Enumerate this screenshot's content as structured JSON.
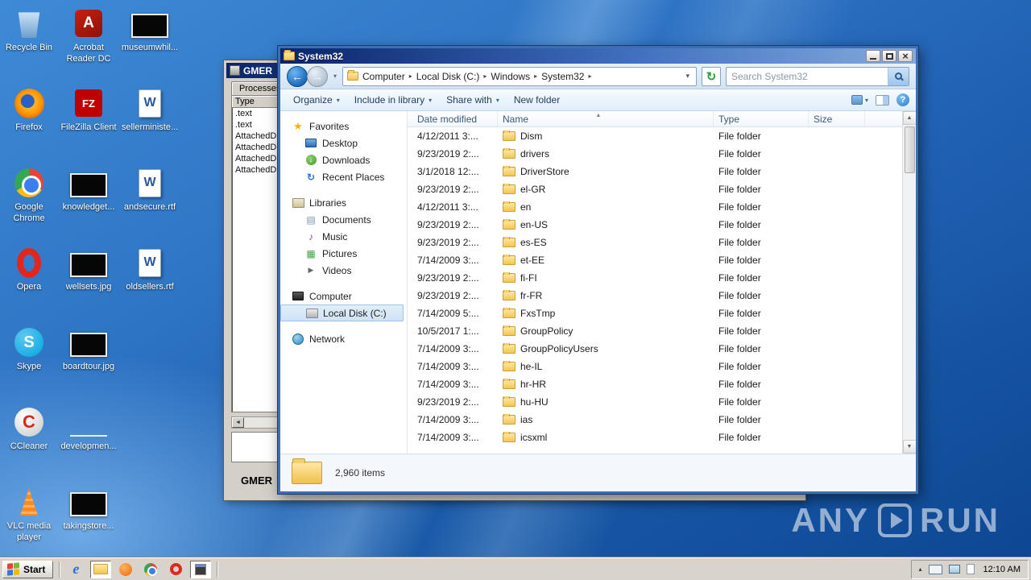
{
  "colors": {
    "window_border": "#3d6db5",
    "selection_blue": "#cfe3f6",
    "wallpaper_blue": "#2e74c4",
    "folder_yellow": "#f3c64f"
  },
  "desktop": {
    "icons": [
      {
        "label": "Recycle Bin",
        "kind": "recycle-bin",
        "col": 0,
        "row": 0
      },
      {
        "label": "Acrobat Reader DC",
        "kind": "acrobat",
        "col": 1,
        "row": 0
      },
      {
        "label": "museumwhil...",
        "kind": "image-black",
        "col": 2,
        "row": 0
      },
      {
        "label": "Firefox",
        "kind": "firefox",
        "col": 0,
        "row": 1
      },
      {
        "label": "FileZilla Client",
        "kind": "filezilla",
        "col": 1,
        "row": 1
      },
      {
        "label": "sellerministe...",
        "kind": "word-doc",
        "col": 2,
        "row": 1
      },
      {
        "label": "Google Chrome",
        "kind": "chrome",
        "col": 0,
        "row": 2
      },
      {
        "label": "knowledget...",
        "kind": "image-black",
        "col": 1,
        "row": 2
      },
      {
        "label": "andsecure.rtf",
        "kind": "word-doc",
        "col": 2,
        "row": 2
      },
      {
        "label": "Opera",
        "kind": "opera",
        "col": 0,
        "row": 3
      },
      {
        "label": "wellsets.jpg",
        "kind": "image-black",
        "col": 1,
        "row": 3
      },
      {
        "label": "oldsellers.rtf",
        "kind": "word-doc",
        "col": 2,
        "row": 3
      },
      {
        "label": "Skype",
        "kind": "skype",
        "col": 0,
        "row": 4
      },
      {
        "label": "boardtour.jpg",
        "kind": "image-black",
        "col": 1,
        "row": 4
      },
      {
        "label": "CCleaner",
        "kind": "ccleaner",
        "col": 0,
        "row": 5
      },
      {
        "label": "developmen...",
        "kind": "image-thin",
        "col": 1,
        "row": 5
      },
      {
        "label": "VLC media player",
        "kind": "vlc",
        "col": 0,
        "row": 6
      },
      {
        "label": "takingstore...",
        "kind": "image-black",
        "col": 1,
        "row": 6
      }
    ]
  },
  "gmer": {
    "title": "GMER",
    "tab_label": "Processes",
    "column_header": "Type",
    "rows": [
      ".text",
      ".text",
      "AttachedD",
      "AttachedD",
      "AttachedD",
      "AttachedD"
    ],
    "footer_label": "GMER"
  },
  "explorer": {
    "window_title": "System32",
    "breadcrumb": {
      "items": [
        "Computer",
        "Local Disk (C:)",
        "Windows",
        "System32"
      ]
    },
    "search": {
      "placeholder": "Search System32"
    },
    "toolbar": {
      "items": [
        {
          "label": "Organize",
          "dropdown": true
        },
        {
          "label": "Include in library",
          "dropdown": true
        },
        {
          "label": "Share with",
          "dropdown": true
        },
        {
          "label": "New folder",
          "dropdown": false
        }
      ]
    },
    "sidebar": {
      "sections": [
        {
          "label": "Favorites",
          "icon": "favorites-star",
          "items": [
            {
              "label": "Desktop",
              "icon": "desktop"
            },
            {
              "label": "Downloads",
              "icon": "downloads"
            },
            {
              "label": "Recent Places",
              "icon": "recent-places"
            }
          ]
        },
        {
          "label": "Libraries",
          "icon": "libraries",
          "items": [
            {
              "label": "Documents",
              "icon": "documents"
            },
            {
              "label": "Music",
              "icon": "music"
            },
            {
              "label": "Pictures",
              "icon": "pictures"
            },
            {
              "label": "Videos",
              "icon": "videos"
            }
          ]
        },
        {
          "label": "Computer",
          "icon": "computer",
          "items": [
            {
              "label": "Local Disk (C:)",
              "icon": "disk",
              "selected": true
            }
          ]
        },
        {
          "label": "Network",
          "icon": "network",
          "items": []
        }
      ]
    },
    "list": {
      "columns": [
        "Date modified",
        "Name",
        "Type",
        "Size"
      ],
      "sort_column": "Name",
      "rows": [
        {
          "date": "4/12/2011 3:...",
          "name": "Dism",
          "type": "File folder"
        },
        {
          "date": "9/23/2019 2:...",
          "name": "drivers",
          "type": "File folder"
        },
        {
          "date": "3/1/2018 12:...",
          "name": "DriverStore",
          "type": "File folder"
        },
        {
          "date": "9/23/2019 2:...",
          "name": "el-GR",
          "type": "File folder"
        },
        {
          "date": "4/12/2011 3:...",
          "name": "en",
          "type": "File folder"
        },
        {
          "date": "9/23/2019 2:...",
          "name": "en-US",
          "type": "File folder"
        },
        {
          "date": "9/23/2019 2:...",
          "name": "es-ES",
          "type": "File folder"
        },
        {
          "date": "7/14/2009 3:...",
          "name": "et-EE",
          "type": "File folder"
        },
        {
          "date": "9/23/2019 2:...",
          "name": "fi-FI",
          "type": "File folder"
        },
        {
          "date": "9/23/2019 2:...",
          "name": "fr-FR",
          "type": "File folder"
        },
        {
          "date": "7/14/2009 5:...",
          "name": "FxsTmp",
          "type": "File folder"
        },
        {
          "date": "10/5/2017 1:...",
          "name": "GroupPolicy",
          "type": "File folder"
        },
        {
          "date": "7/14/2009 3:...",
          "name": "GroupPolicyUsers",
          "type": "File folder"
        },
        {
          "date": "7/14/2009 3:...",
          "name": "he-IL",
          "type": "File folder"
        },
        {
          "date": "7/14/2009 3:...",
          "name": "hr-HR",
          "type": "File folder"
        },
        {
          "date": "9/23/2019 2:...",
          "name": "hu-HU",
          "type": "File folder"
        },
        {
          "date": "7/14/2009 3:...",
          "name": "ias",
          "type": "File folder"
        },
        {
          "date": "7/14/2009 3:...",
          "name": "icsxml",
          "type": "File folder"
        }
      ]
    },
    "status_bar": {
      "items_count": "2,960 items"
    }
  },
  "taskbar": {
    "start_label": "Start",
    "quick_launch": [
      "internet-explorer",
      "windows-explorer",
      "media-player",
      "chrome",
      "opera",
      "gmer"
    ],
    "clock": "12:10 AM"
  },
  "watermark": {
    "left": "ANY",
    "right": "RUN"
  }
}
